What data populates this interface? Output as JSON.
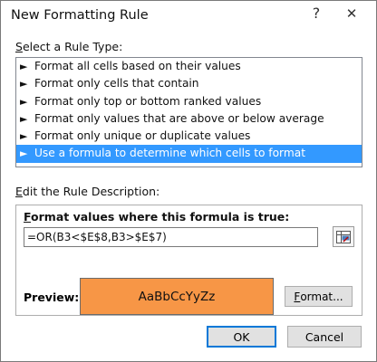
{
  "dialog": {
    "title": "New Formatting Rule",
    "help_glyph": "?",
    "close_glyph": "✕"
  },
  "rule_type": {
    "label": "elect a Rule Type:",
    "label_mnemonic": "S",
    "items": [
      {
        "label": "Format all cells based on their values",
        "selected": false
      },
      {
        "label": "Format only cells that contain",
        "selected": false
      },
      {
        "label": "Format only top or bottom ranked values",
        "selected": false
      },
      {
        "label": "Format only values that are above or below average",
        "selected": false
      },
      {
        "label": "Format only unique or duplicate values",
        "selected": false
      },
      {
        "label": "Use a formula to determine which cells to format",
        "selected": true
      }
    ],
    "arrow_glyph": "►"
  },
  "description": {
    "label": "dit the Rule Description:",
    "label_mnemonic": "E",
    "formula_label": "ormat values where this formula is true:",
    "formula_mnemonic": "F",
    "formula_value": "=OR(B3<$E$8,B3>$E$7)",
    "preview_label": "Preview:",
    "preview_sample": "AaBbCcYyZz",
    "preview_fill": "#f79646",
    "format_button": "ormat...",
    "format_mnemonic": "F"
  },
  "footer": {
    "ok_label": "OK",
    "cancel_label": "Cancel"
  },
  "colors": {
    "selection": "#3399ff",
    "accent_border": "#0078d7"
  }
}
